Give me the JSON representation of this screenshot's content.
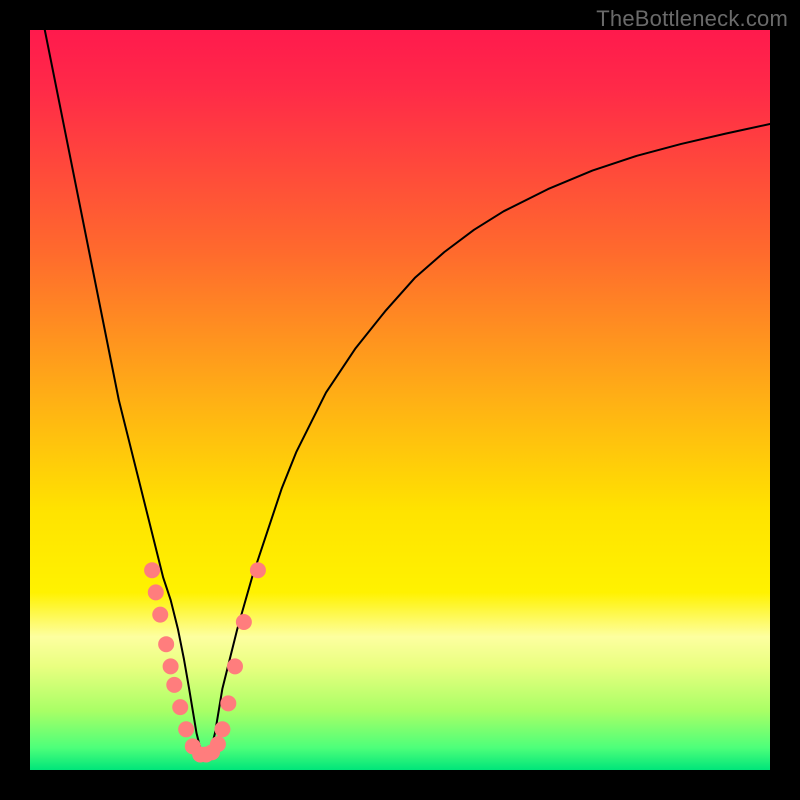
{
  "watermark": {
    "text": "TheBottleneck.com"
  },
  "chart_data": {
    "type": "line",
    "title": "",
    "xlabel": "",
    "ylabel": "",
    "xlim": [
      0,
      100
    ],
    "ylim": [
      0,
      100
    ],
    "gradient_stops": [
      {
        "offset": 0.0,
        "color": "#ff1a4d"
      },
      {
        "offset": 0.08,
        "color": "#ff2a48"
      },
      {
        "offset": 0.3,
        "color": "#ff6a2d"
      },
      {
        "offset": 0.5,
        "color": "#ffb015"
      },
      {
        "offset": 0.65,
        "color": "#ffe300"
      },
      {
        "offset": 0.76,
        "color": "#fff200"
      },
      {
        "offset": 0.82,
        "color": "#fdffa0"
      },
      {
        "offset": 0.86,
        "color": "#e9ff80"
      },
      {
        "offset": 0.92,
        "color": "#a9ff66"
      },
      {
        "offset": 0.97,
        "color": "#4dff7a"
      },
      {
        "offset": 1.0,
        "color": "#00e57a"
      }
    ],
    "series": [
      {
        "name": "bottleneck-curve",
        "stroke": "#000000",
        "stroke_width": 2,
        "x": [
          2,
          3,
          4,
          5,
          6,
          7,
          8,
          9,
          10,
          11,
          12,
          13,
          14,
          15,
          16,
          17,
          18,
          19,
          20,
          20.8,
          21.5,
          22,
          22.5,
          23,
          23.5,
          24,
          24.5,
          25,
          25.5,
          26,
          27,
          28,
          30,
          32,
          34,
          36,
          38,
          40,
          44,
          48,
          52,
          56,
          60,
          64,
          70,
          76,
          82,
          88,
          94,
          100
        ],
        "y": [
          100,
          95,
          90,
          85,
          80,
          75,
          70,
          65,
          60,
          55,
          50,
          46,
          42,
          38,
          34,
          30,
          26,
          23,
          19,
          15,
          11,
          8,
          5,
          3,
          2,
          2,
          3,
          5,
          8,
          11,
          15,
          19,
          26,
          32,
          38,
          43,
          47,
          51,
          57,
          62,
          66.5,
          70,
          73,
          75.5,
          78.5,
          81,
          83,
          84.6,
          86,
          87.3
        ]
      }
    ],
    "markers": {
      "name": "cluster-dots",
      "fill": "#ff7d7d",
      "radius": 8,
      "points": [
        {
          "x": 16.5,
          "y": 27
        },
        {
          "x": 17.0,
          "y": 24
        },
        {
          "x": 17.6,
          "y": 21
        },
        {
          "x": 18.4,
          "y": 17
        },
        {
          "x": 19.0,
          "y": 14
        },
        {
          "x": 19.5,
          "y": 11.5
        },
        {
          "x": 20.3,
          "y": 8.5
        },
        {
          "x": 21.1,
          "y": 5.5
        },
        {
          "x": 22.0,
          "y": 3.2
        },
        {
          "x": 23.0,
          "y": 2.1
        },
        {
          "x": 23.8,
          "y": 2.1
        },
        {
          "x": 24.6,
          "y": 2.4
        },
        {
          "x": 25.4,
          "y": 3.5
        },
        {
          "x": 26.0,
          "y": 5.5
        },
        {
          "x": 26.8,
          "y": 9.0
        },
        {
          "x": 27.7,
          "y": 14.0
        },
        {
          "x": 28.9,
          "y": 20.0
        },
        {
          "x": 30.8,
          "y": 27.0
        }
      ]
    }
  }
}
